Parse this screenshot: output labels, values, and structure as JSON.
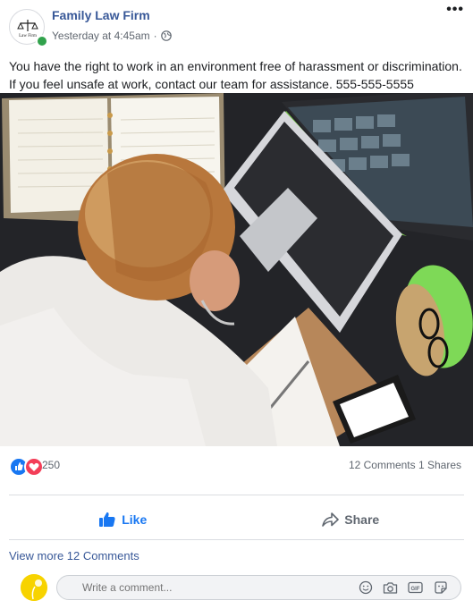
{
  "post": {
    "page_name": "Family Law Firm",
    "timestamp": "Yesterday at 4:45am",
    "separator": "·",
    "menu_label": "•••",
    "avatar_logo_text": "Law Firm",
    "text": "You have the right to work in an environment free of harassment or discrimination. If you feel unsafe at work, contact our team for assistance. 555-555-5555"
  },
  "engagement": {
    "reaction_count": "250",
    "comments_shares": "12 Comments 1 Shares"
  },
  "actions": {
    "like_label": "Like",
    "share_label": "Share"
  },
  "comments": {
    "view_more": "View more 12 Comments",
    "placeholder": "Write a comment..."
  },
  "icons": {
    "audience": "globe-icon",
    "like": "thumbs-up-icon",
    "share": "share-arrow-icon",
    "emoji": "smiley-icon",
    "camera": "camera-icon",
    "gif": "gif-icon",
    "sticker": "sticker-icon"
  },
  "colors": {
    "brand_blue": "#1877f2",
    "link_blue": "#385898",
    "love_red": "#f33e58",
    "online_green": "#31a24c",
    "avatar_yellow": "#f7d300"
  }
}
